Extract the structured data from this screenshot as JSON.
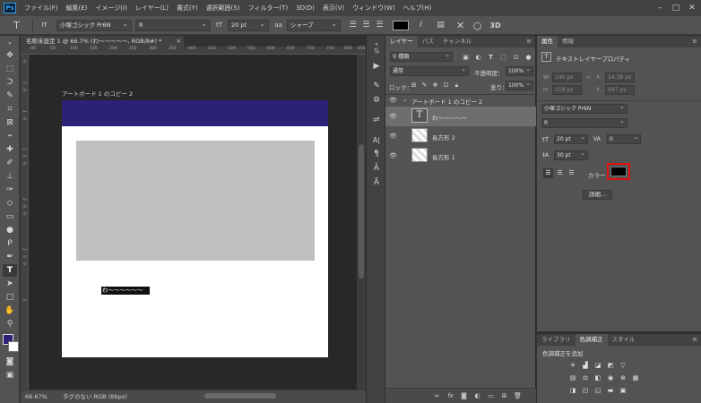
{
  "menubar": {
    "app_icon": "Ps",
    "items": [
      "ファイル(F)",
      "編集(E)",
      "イメージ(I)",
      "レイヤー(L)",
      "書式(Y)",
      "選択範囲(S)",
      "フィルター(T)",
      "3D(D)",
      "表示(V)",
      "ウィンドウ(W)",
      "ヘルプ(H)"
    ]
  },
  "options": {
    "tool_icon": "T",
    "orient_icon": "IT",
    "font_family": "小塚ゴシック Pr6N",
    "font_style": "R",
    "size_icon": "tT",
    "font_size": "20 pt",
    "aa_icon": "aa",
    "antialias": "シャープ",
    "text_color": "#000000",
    "label_3d": "3D"
  },
  "document": {
    "tab_title": "名称未設定 1 @ 66.7% (わ〜〜〜〜〜, RGB/8#) *",
    "artboard_label": "アートボード 1 のコピー 2",
    "text_content": "わ〜〜〜〜〜〜",
    "ruler_ticks": [
      "00",
      "50",
      "100",
      "150",
      "200",
      "250",
      "300",
      "350",
      "400",
      "450",
      "500",
      "550",
      "600",
      "650",
      "700",
      "750",
      "800",
      "850"
    ],
    "ruler_left_ticks": [
      "0",
      "5",
      "0",
      "1",
      "0",
      "1",
      "5",
      "0",
      "2",
      "0",
      "0",
      "2",
      "5",
      "0",
      "3"
    ],
    "band_color": "#2b2176",
    "rect_color": "#c0c0c0"
  },
  "status": {
    "zoom": "66.67%",
    "profile": "タグのない RGB (8bpc)"
  },
  "layers": {
    "tabs": [
      "レイヤー",
      "パス",
      "チャンネル"
    ],
    "filter_kind": "種類",
    "blend_mode": "通常",
    "opacity_label": "不透明度：",
    "opacity": "100%",
    "lock_label": "ロック：",
    "fill_label": "塗り：",
    "fill": "100%",
    "group_name": "アートボード 1 のコピー 2",
    "items": [
      {
        "name": "わ〜〜〜〜〜",
        "kind": "text"
      },
      {
        "name": "長方形 2",
        "kind": "shape"
      },
      {
        "name": "長方形 1",
        "kind": "shape"
      }
    ],
    "bottom_icons": [
      "link-icon",
      "fx-icon",
      "mask-icon",
      "adjustment-icon",
      "folder-icon",
      "new-layer-icon",
      "trash-icon"
    ]
  },
  "properties": {
    "tabs": [
      "属性",
      "情報"
    ],
    "header": "テキストレイヤープロパティ",
    "w_label": "W:",
    "w_value": "140 px",
    "h_label": "H:",
    "h_value": "118 px",
    "x_label": "X:",
    "x_value": "24.38 px",
    "y_label": "Y:",
    "y_value": "547 px",
    "font_family": "小塚ゴシック Pr6N",
    "font_style": "R",
    "font_size": "20 pt",
    "tracking": "0",
    "leading": "30 pt",
    "color_label": "カラー：",
    "color": "#000000",
    "detail_button": "詳細..."
  },
  "adjustments": {
    "tabs": [
      "ライブラリ",
      "色調補正",
      "スタイル"
    ],
    "header": "色調補正を追加"
  },
  "colors": {
    "foreground": "#2b2176",
    "background": "#ffffff",
    "highlight": "#e01010"
  }
}
